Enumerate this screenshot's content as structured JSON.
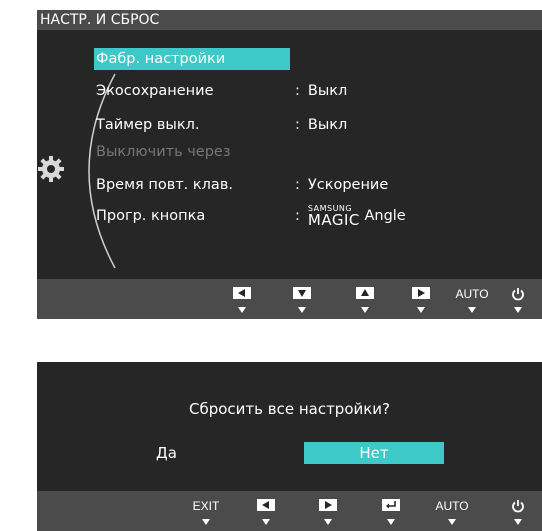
{
  "menu_panel": {
    "title": "НАСТР. И СБРОС",
    "items": [
      {
        "label": "Фабр. настройки",
        "value": ""
      },
      {
        "label": "Экосохранение",
        "value": "Выкл"
      },
      {
        "label": "Таймер выкл.",
        "value": "Выкл"
      },
      {
        "label": "Выключить через",
        "value": ""
      },
      {
        "label": "Время повт. клав.",
        "value": "Ускорение"
      },
      {
        "label": "Прогр. кнопка",
        "value": "Angle"
      }
    ],
    "magic_logo": {
      "brand": "SAMSUNG",
      "word": "MAGIC"
    },
    "colon": ":",
    "buttons": {
      "auto": "AUTO"
    }
  },
  "dialog_panel": {
    "question": "Сбросить все настройки?",
    "yes": "Да",
    "no": "Нет",
    "buttons": {
      "exit": "EXIT",
      "auto": "AUTO"
    }
  },
  "colors": {
    "accent": "#3ec9c9",
    "panel": "#262626",
    "bar": "#4b4b4b"
  }
}
